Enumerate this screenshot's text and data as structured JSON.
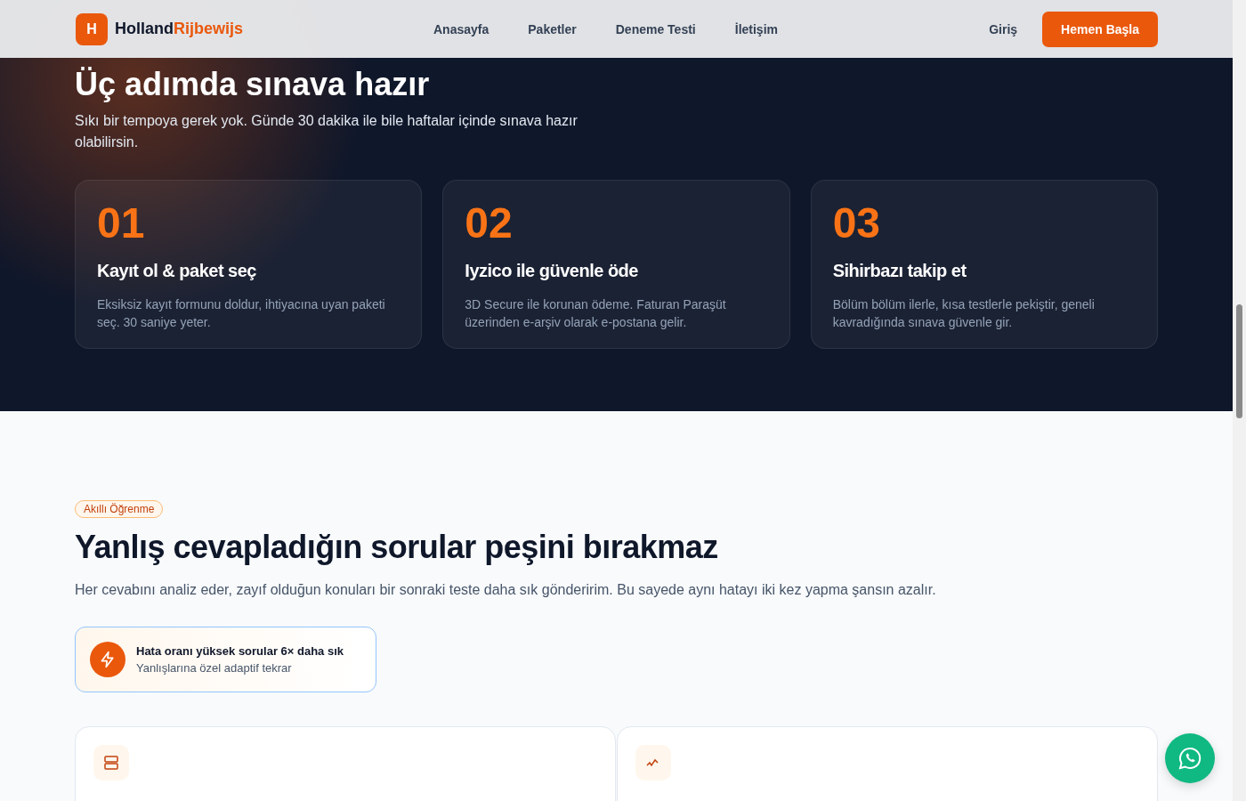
{
  "header": {
    "logo": {
      "mark": "H",
      "name_part_1": "Holland",
      "name_part_2": "Rijbewijs"
    },
    "nav": [
      {
        "label": "Anasayfa",
        "selected": false
      },
      {
        "label": "Paketler",
        "selected": false
      },
      {
        "label": "Deneme Testi",
        "selected": false
      },
      {
        "label": "İletişim",
        "selected": false
      }
    ],
    "login": "Giriş",
    "cta": "Hemen Başla"
  },
  "steps_section": {
    "title": "Üç adımda sınava hazır",
    "subtitle": "Sıkı bir tempoya gerek yok. Günde 30 dakika ile bile haftalar içinde sınava hazır olabilirsin.",
    "steps": [
      {
        "number": "01",
        "title": "Kayıt ol & paket seç",
        "text": "Eksiksiz kayıt formunu doldur, ihtiyacına uyan paketi seç. 30 saniye yeter."
      },
      {
        "number": "02",
        "title": "Iyzico ile güvenle öde",
        "text": "3D Secure ile korunan ödeme. Faturan Paraşüt üzerinden e-arşiv olarak e-postana gelir."
      },
      {
        "number": "03",
        "title": "Sihirbazı takip et",
        "text": "Bölüm bölüm ilerle, kısa testlerle pekiştir, geneli kavradığında sınava güvenle gir."
      }
    ]
  },
  "learning_section": {
    "badge": "Akıllı Öğrenme",
    "title": "Yanlış cevapladığın sorular peşini bırakmaz",
    "text": "Her cevabını analiz eder, zayıf olduğun konuları bir sonraki teste daha sık gönderirim. Bu sayede aynı hatayı iki kez yapma şansın azalır.",
    "highlight": {
      "title": "Hata oranı yüksek sorular 6× daha sık",
      "subtitle": "Yanlışlarına özel adaptif tekrar"
    },
    "features": [
      {
        "kind": "stack"
      },
      {
        "kind": "trend"
      }
    ]
  }
}
